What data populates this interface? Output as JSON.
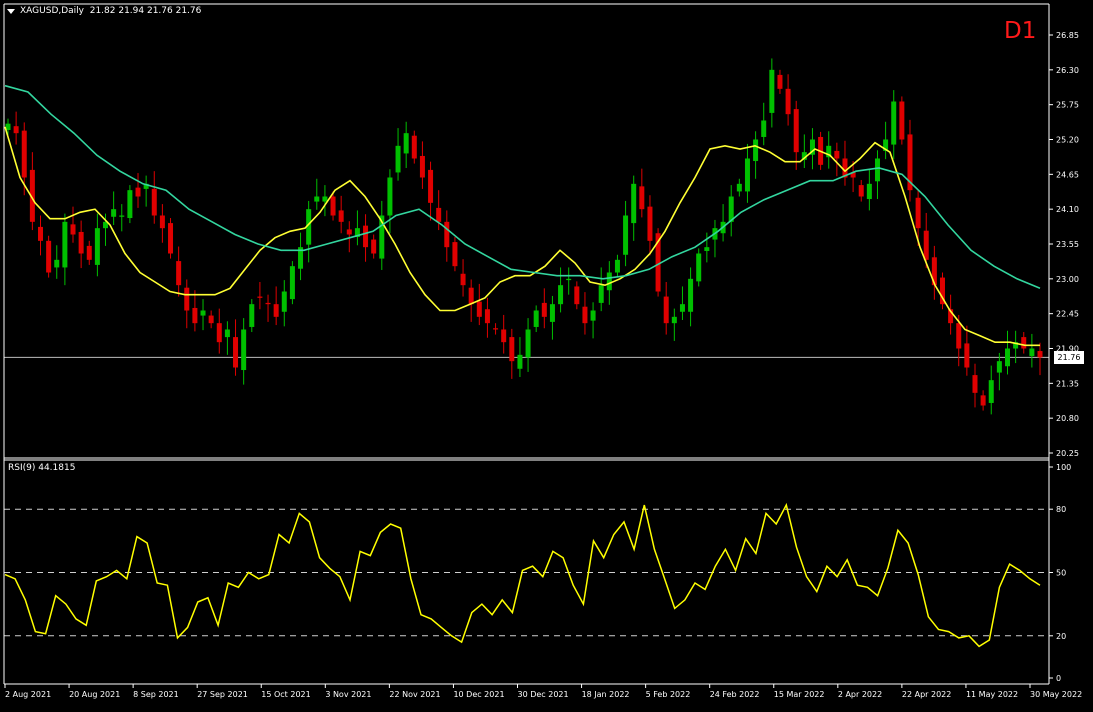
{
  "header": {
    "symbol_info": "XAGUSD,Daily  21.82 21.94 21.76 21.76",
    "timeframe_badge": "D1",
    "rsi_label": "RSI(9) 44.1815",
    "current_price_label": "21.76"
  },
  "colors": {
    "background": "#000000",
    "bull_candle": "#00c000",
    "bear_candle": "#e00000",
    "ma_fast": "#ffff33",
    "ma_slow": "#33d69f",
    "rsi_line": "#ffff00",
    "grid_dash": "#cfcfcf",
    "axis": "#ffffff",
    "timeframe_badge": "#ff1a1a"
  },
  "chart_data": [
    {
      "type": "candlestick",
      "title": "XAGUSD,Daily",
      "ylim": [
        20.25,
        26.85
      ],
      "y_ticks": [
        26.85,
        26.3,
        25.75,
        25.2,
        24.65,
        24.1,
        23.55,
        23.0,
        22.45,
        21.9,
        21.35,
        20.8,
        20.25
      ],
      "x_ticks": [
        "2 Aug 2021",
        "20 Aug 2021",
        "8 Sep 2021",
        "27 Sep 2021",
        "15 Oct 2021",
        "3 Nov 2021",
        "22 Nov 2021",
        "10 Dec 2021",
        "30 Dec 2021",
        "18 Jan 2022",
        "5 Feb 2022",
        "24 Feb 2022",
        "15 Mar 2022",
        "2 Apr 2022",
        "22 Apr 2022",
        "11 May 2022",
        "30 May 2022"
      ],
      "current_price": 21.76,
      "close_series_approx": [
        25.45,
        25.3,
        24.6,
        23.9,
        23.6,
        23.1,
        23.3,
        23.9,
        23.7,
        23.4,
        23.3,
        23.8,
        23.9,
        24.1,
        24.0,
        24.4,
        24.3,
        24.5,
        24.0,
        23.8,
        23.4,
        22.9,
        22.5,
        22.3,
        22.5,
        22.3,
        22.0,
        22.2,
        21.6,
        22.2,
        22.6,
        22.7,
        22.6,
        22.4,
        22.8,
        23.2,
        23.5,
        24.1,
        24.3,
        24.3,
        24.0,
        23.9,
        23.7,
        23.8,
        23.5,
        23.4,
        24.0,
        24.6,
        25.1,
        25.3,
        24.9,
        24.6,
        24.2,
        23.9,
        23.5,
        23.2,
        22.9,
        22.6,
        22.4,
        22.3,
        22.2,
        22.0,
        21.7,
        21.8,
        22.2,
        22.5,
        22.4,
        22.6,
        22.9,
        23.0,
        22.6,
        22.3,
        22.5,
        22.9,
        23.1,
        23.3,
        24.0,
        24.5,
        24.1,
        23.6,
        22.8,
        22.3,
        22.4,
        22.6,
        23.0,
        23.4,
        23.5,
        23.8,
        23.9,
        24.3,
        24.5,
        24.9,
        25.2,
        25.5,
        26.3,
        26.0,
        25.6,
        25.0,
        25.0,
        25.2,
        24.8,
        25.1,
        24.9,
        24.6,
        24.6,
        24.3,
        24.5,
        24.9,
        25.2,
        25.8,
        25.2,
        24.4,
        23.8,
        23.3,
        22.9,
        22.6,
        22.3,
        21.9,
        21.6,
        21.2,
        21.0,
        21.4,
        21.7,
        21.9,
        22.0,
        21.9,
        21.9,
        21.76
      ],
      "indicators": [
        {
          "name": "fast MA (yellow)",
          "values_approx": [
            25.4,
            24.6,
            24.2,
            23.95,
            23.95,
            24.05,
            24.1,
            23.85,
            23.4,
            23.1,
            22.95,
            22.8,
            22.75,
            22.75,
            22.75,
            22.85,
            23.15,
            23.45,
            23.65,
            23.75,
            23.8,
            24.05,
            24.4,
            24.55,
            24.3,
            23.95,
            23.55,
            23.1,
            22.75,
            22.5,
            22.5,
            22.6,
            22.7,
            22.95,
            23.05,
            23.05,
            23.2,
            23.45,
            23.25,
            22.95,
            22.9,
            23.0,
            23.15,
            23.4,
            23.75,
            24.2,
            24.6,
            25.05,
            25.1,
            25.05,
            25.1,
            25.0,
            24.85,
            24.85,
            25.05,
            24.95,
            24.7,
            24.9,
            25.15,
            25.0,
            24.3,
            23.5,
            22.9,
            22.5,
            22.2,
            22.1,
            22.0,
            22.0,
            21.95,
            21.95
          ]
        },
        {
          "name": "slow MA (green)",
          "values_approx": [
            26.05,
            25.95,
            25.6,
            25.3,
            24.95,
            24.7,
            24.5,
            24.4,
            24.1,
            23.9,
            23.7,
            23.55,
            23.45,
            23.45,
            23.55,
            23.65,
            23.75,
            24.0,
            24.1,
            23.85,
            23.55,
            23.35,
            23.15,
            23.1,
            23.05,
            23.05,
            23.0,
            23.05,
            23.15,
            23.35,
            23.5,
            23.75,
            24.05,
            24.25,
            24.4,
            24.55,
            24.55,
            24.7,
            24.75,
            24.65,
            24.3,
            23.85,
            23.45,
            23.2,
            23.0,
            22.85
          ]
        }
      ]
    },
    {
      "type": "line",
      "title": "RSI(9) 44.1815",
      "ylim": [
        0,
        100
      ],
      "y_ticks": [
        100,
        80,
        50,
        20,
        0
      ],
      "levels": [
        80,
        50,
        20
      ],
      "series": [
        {
          "name": "RSI(9)",
          "values_approx": [
            49,
            47,
            37,
            22,
            21,
            39,
            35,
            28,
            25,
            46,
            48,
            51,
            47,
            67,
            64,
            45,
            44,
            19,
            24,
            36,
            38,
            25,
            45,
            43,
            50,
            47,
            49,
            68,
            64,
            78,
            74,
            57,
            52,
            48,
            37,
            60,
            58,
            69,
            73,
            71,
            47,
            30,
            28,
            24,
            20,
            17,
            31,
            35,
            30,
            37,
            31,
            51,
            53,
            48,
            60,
            57,
            44,
            35,
            65,
            57,
            68,
            74,
            61,
            82,
            61,
            47,
            33,
            37,
            45,
            42,
            53,
            61,
            51,
            66,
            59,
            78,
            73,
            82,
            62,
            48,
            41,
            53,
            48,
            56,
            44,
            43,
            39,
            52,
            70,
            64,
            49,
            29,
            23,
            22,
            19,
            20,
            15,
            18,
            43,
            54,
            51,
            47,
            44
          ]
        }
      ]
    }
  ]
}
